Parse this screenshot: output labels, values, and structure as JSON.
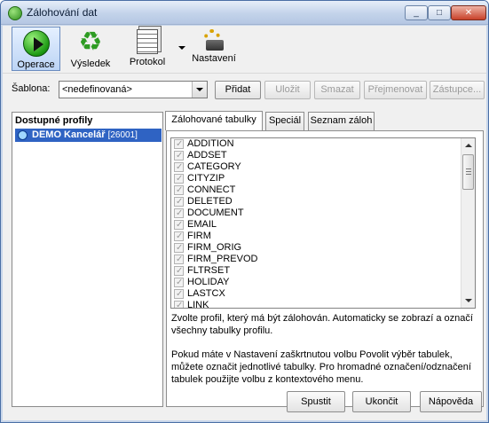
{
  "window": {
    "title": "Zálohování dat",
    "controls": {
      "minimize": "_",
      "maximize": "□",
      "close": "✕"
    }
  },
  "toolbar": {
    "items": [
      {
        "label": "Operace",
        "icon": "play-icon"
      },
      {
        "label": "Výsledek",
        "icon": "recycle-icon"
      },
      {
        "label": "Protokol",
        "icon": "document-icon"
      },
      {
        "label": "Nastavení",
        "icon": "settings-icon"
      }
    ]
  },
  "template": {
    "label": "Šablona:",
    "value": "<nedefinovaná>",
    "buttons": {
      "add": "Přidat",
      "save": "Uložit",
      "delete": "Smazat",
      "rename": "Přejmenovat",
      "deputy": "Zástupce..."
    }
  },
  "profiles": {
    "title": "Dostupné profily",
    "items": [
      {
        "name": "DEMO Kancelář",
        "code": "[26001]"
      }
    ]
  },
  "tabs": [
    "Zálohované tabulky",
    "Speciál",
    "Seznam záloh"
  ],
  "tables": [
    "ADDITION",
    "ADDSET",
    "CATEGORY",
    "CITYZIP",
    "CONNECT",
    "DELETED",
    "DOCUMENT",
    "EMAIL",
    "FIRM",
    "FIRM_ORIG",
    "FIRM_PREVOD",
    "FLTRSET",
    "HOLIDAY",
    "LASTCX",
    "LINK"
  ],
  "hint": {
    "p1": "Zvolte profil, který má být zálohován. Automaticky se zobrazí a označí všechny tabulky profilu.",
    "p2": "Pokud máte v Nastavení zaškrtnutou volbu Povolit výběr tabulek, můžete označit jednotlivé tabulky. Pro hromadné označení/odznačení tabulek použijte volbu z kontextového menu."
  },
  "footer": {
    "run": "Spustit",
    "close": "Ukončit",
    "help": "Nápověda"
  }
}
